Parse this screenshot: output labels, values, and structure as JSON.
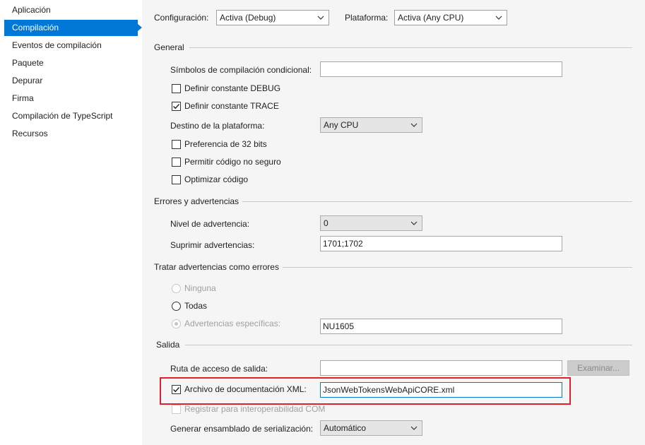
{
  "sidebar": {
    "items": [
      {
        "label": "Aplicación"
      },
      {
        "label": "Compilación"
      },
      {
        "label": "Eventos de compilación"
      },
      {
        "label": "Paquete"
      },
      {
        "label": "Depurar"
      },
      {
        "label": "Firma"
      },
      {
        "label": "Compilación de TypeScript"
      },
      {
        "label": "Recursos"
      }
    ],
    "active_index": 1
  },
  "top": {
    "config_label": "Configuración:",
    "config_value": "Activa (Debug)",
    "platform_label": "Plataforma:",
    "platform_value": "Activa (Any CPU)"
  },
  "general": {
    "title": "General",
    "symbols_label": "Símbolos de compilación condicional:",
    "symbols_value": "",
    "debug_label": "Definir constante DEBUG",
    "debug_checked": false,
    "trace_label": "Definir constante TRACE",
    "trace_checked": true,
    "target_label": "Destino de la plataforma:",
    "target_value": "Any CPU",
    "prefer32_label": "Preferencia de 32 bits",
    "unsafe_label": "Permitir código no seguro",
    "optimize_label": "Optimizar código"
  },
  "errors": {
    "title": "Errores y advertencias",
    "level_label": "Nivel de advertencia:",
    "level_value": "0",
    "suppress_label": "Suprimir advertencias:",
    "suppress_value": "1701;1702"
  },
  "treat": {
    "title": "Tratar advertencias como errores",
    "none_label": "Ninguna",
    "all_label": "Todas",
    "specific_label": "Advertencias específicas:",
    "specific_value": "NU1605"
  },
  "output": {
    "title": "Salida",
    "path_label": "Ruta de acceso de salida:",
    "path_value": "",
    "browse_label": "Examinar...",
    "xmldoc_label": "Archivo de documentación XML:",
    "xmldoc_checked": true,
    "xmldoc_value": "JsonWebTokensWebApiCORE.xml",
    "interop_label": "Registrar para interoperabilidad COM",
    "serialization_label": "Generar ensamblado de serialización:",
    "serialization_value": "Automático"
  },
  "colors": {
    "accent": "#0078d7",
    "highlight": "#e0202a"
  }
}
